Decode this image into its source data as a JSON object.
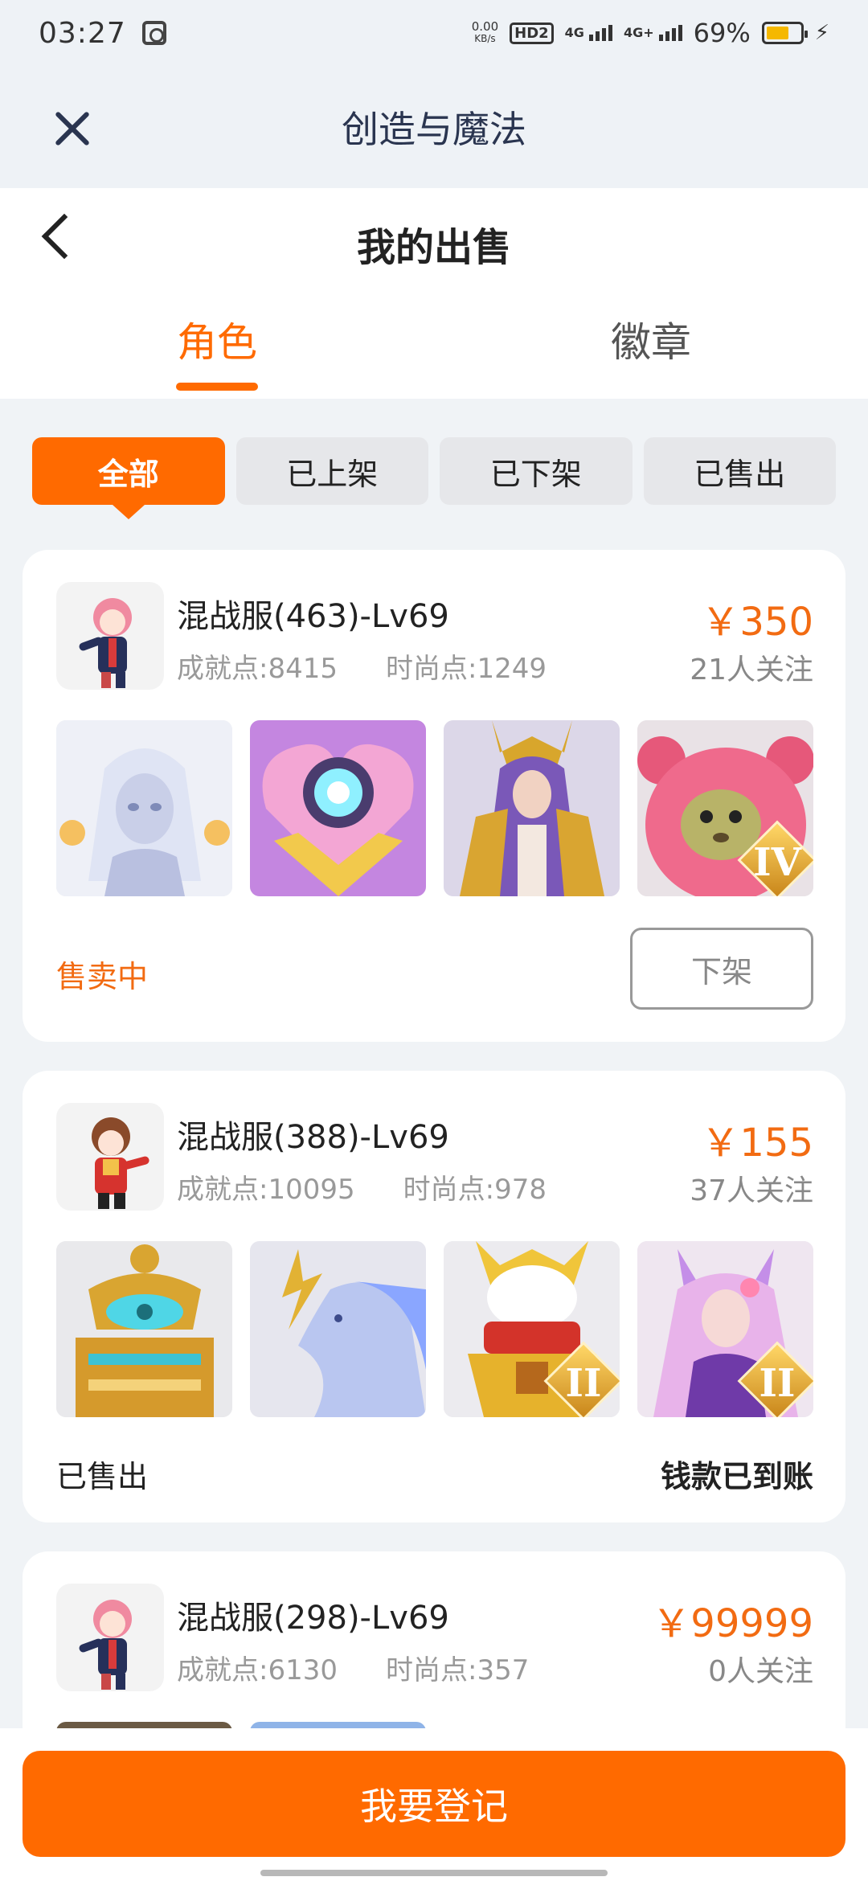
{
  "status_bar": {
    "time": "03:27",
    "net_speed": "0.00",
    "net_speed_unit": "KB/s",
    "hd_label": "HD2",
    "sim1_label": "4G",
    "sim2_label": "4G+",
    "battery_percent": "69%",
    "battery_level": 0.69
  },
  "app_bar": {
    "title": "创造与魔法"
  },
  "page": {
    "title": "我的出售",
    "tabs": [
      {
        "label": "角色",
        "active": true
      },
      {
        "label": "徽章",
        "active": false
      }
    ],
    "filters": [
      {
        "label": "全部",
        "active": true
      },
      {
        "label": "已上架",
        "active": false
      },
      {
        "label": "已下架",
        "active": false
      },
      {
        "label": "已售出",
        "active": false
      }
    ]
  },
  "listings": [
    {
      "title": "混战服(463)-Lv69",
      "achievement": "成就点:8415",
      "fashion": "时尚点:1249",
      "price": "￥350",
      "followers": "21人关注",
      "status": "售卖中",
      "action": "下架",
      "thumbs": [
        "white-fairy",
        "heart-emblem",
        "golden-priestess",
        "pink-bear"
      ],
      "badges": [
        "",
        "",
        "",
        "IV"
      ]
    },
    {
      "title": "混战服(388)-Lv69",
      "achievement": "成就点:10095",
      "fashion": "时尚点:978",
      "price": "￥155",
      "followers": "37人关注",
      "status": "已售出",
      "note": "钱款已到账",
      "thumbs": [
        "golden-throne",
        "lightning-horse",
        "golden-armor",
        "pink-fox-girl"
      ],
      "badges": [
        "",
        "",
        "II",
        "II"
      ]
    },
    {
      "title": "混战服(298)-Lv69",
      "achievement": "成就点:6130",
      "fashion": "时尚点:357",
      "price": "￥99999",
      "followers": "0人关注"
    }
  ],
  "bottom": {
    "register_label": "我要登记"
  },
  "colors": {
    "accent": "#ff6a00",
    "price": "#f26b12"
  }
}
